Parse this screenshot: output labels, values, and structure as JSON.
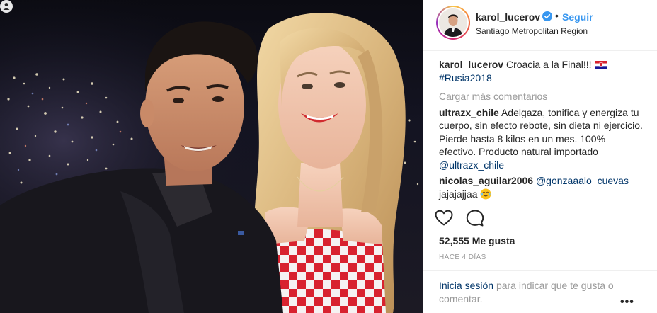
{
  "header": {
    "username": "karol_lucerov",
    "separator": "•",
    "follow_label": "Seguir",
    "location": "Santiago Metropolitan Region"
  },
  "caption": {
    "user": "karol_lucerov",
    "text": "Croacia a la Final!!!",
    "hashtag": "#Rusia2018"
  },
  "load_more_label": "Cargar más comentarios",
  "comments": [
    {
      "user": "ultrazx_chile",
      "text": "Adelgaza, tonifica y energiza tu cuerpo, sin efecto rebote, sin dieta ni ejercicio. Pierde hasta 8 kilos en un mes. 100% efectivo. Producto natural importado",
      "mention": "@ultrazx_chile"
    },
    {
      "user": "nicolas_aguilar2006",
      "mention": "@gonzaaalo_cuevas",
      "text": "jajajajjaa"
    }
  ],
  "likes": "52,555 Me gusta",
  "time": "HACE 4 DÍAS",
  "login": {
    "link": "Inicia sesión",
    "text": "para indicar que te gusta o comentar."
  },
  "more_label": "•••",
  "icons": {
    "like": "heart-icon",
    "comment": "comment-icon",
    "verified": "verified-badge-icon",
    "carousel": "carousel-icon"
  },
  "colors": {
    "link_blue": "#3897f0",
    "dark_link": "#003569",
    "muted": "#999999",
    "text": "#262626"
  }
}
